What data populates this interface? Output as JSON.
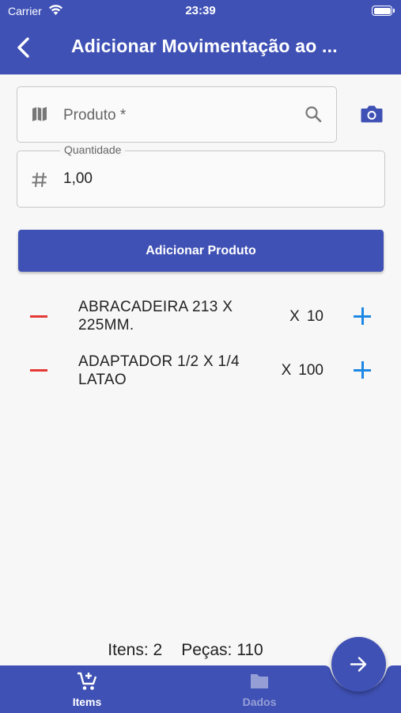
{
  "status_bar": {
    "carrier": "Carrier",
    "time": "23:39"
  },
  "header": {
    "title": "Adicionar Movimentação ao ...",
    "back_icon": "chevron-left-icon"
  },
  "form": {
    "product": {
      "placeholder": "Produto *",
      "leading_icon": "map-icon",
      "trailing_icon": "search-icon"
    },
    "camera_icon": "camera-icon",
    "quantity": {
      "label": "Quantidade",
      "value": "1,00",
      "leading_icon": "hash-icon"
    },
    "add_button_label": "Adicionar Produto"
  },
  "items": [
    {
      "name": "ABRACADEIRA 213 X 225MM.",
      "x_label": "X",
      "quantity": "10"
    },
    {
      "name": "ADAPTADOR 1/2 X 1/4 LATAO",
      "x_label": "X",
      "quantity": "100"
    }
  ],
  "summary": {
    "items_text": "Itens: 2",
    "pieces_text": "Peças: 110"
  },
  "bottom_nav": {
    "tabs": [
      {
        "label": "Items",
        "icon": "cart-plus-icon",
        "active": true
      },
      {
        "label": "Dados",
        "icon": "folder-icon",
        "active": false
      }
    ],
    "fab_icon": "arrow-right-icon"
  },
  "colors": {
    "primary": "#3f51b5",
    "remove": "#e53935",
    "add": "#1e88e5"
  }
}
